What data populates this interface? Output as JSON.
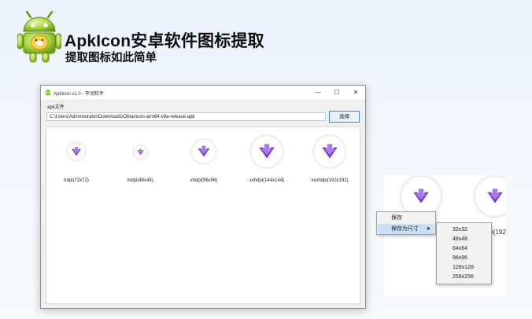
{
  "banner": {
    "title": "ApkIcon安卓软件图标提取",
    "subtitle": "提取图标如此简单",
    "logo_icon": "android-robot-icon"
  },
  "window": {
    "title": "ApkIcon v1.0 - 李润软件",
    "controls": {
      "minimize": "—",
      "maximize": "☐",
      "close": "✕"
    },
    "apk_label": "apk文件",
    "path_value": "C:\\Users\\Administrator\\Downloads\\Obtainium-arm64-v8a-release.apk",
    "select_button": "选择",
    "icons": [
      {
        "label": "hdpi(72x72)"
      },
      {
        "label": "mdpi(48x48)"
      },
      {
        "label": "xhdpi(96x96)"
      },
      {
        "label": "xxhdpi(144x144)"
      },
      {
        "label": "xxxhdpi(192x192)"
      }
    ]
  },
  "zoom": {
    "partial_label": "i(192"
  },
  "context_menu": {
    "save": "保存",
    "save_as": "保存为尺寸",
    "submenu_arrow": "▶",
    "sizes": [
      "32x32",
      "48x48",
      "64x64",
      "96x96",
      "128x128",
      "256x256"
    ]
  },
  "colors": {
    "icon_purple": "#7b3fd6",
    "menu_highlight": "#c9dff5",
    "select_border": "#3c8be0"
  }
}
